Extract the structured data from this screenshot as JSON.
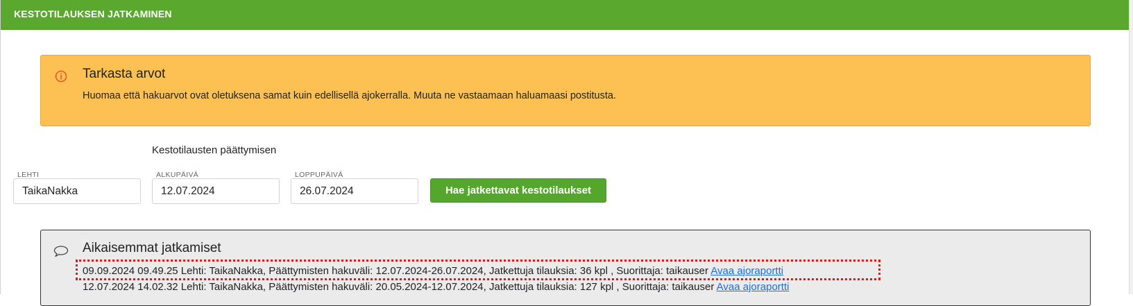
{
  "header": {
    "title": "KESTOTILAUKSEN JATKAMINEN"
  },
  "warning": {
    "icon": "info-circle-icon",
    "title": "Tarkasta arvot",
    "text": "Huomaa että hakuarvot ovat oletuksena samat kuin edellisellä ajokerralla. Muuta ne vastaamaan haluamaasi postitusta."
  },
  "form": {
    "range_label": "Kestotilausten päättymisen",
    "lehti": {
      "label": "LEHTI",
      "value": "TaikaNakka"
    },
    "alkupaiva": {
      "label": "ALKUPÄIVÄ",
      "value": "12.07.2024"
    },
    "loppupaiva": {
      "label": "LOPPUPÄIVÄ",
      "value": "26.07.2024"
    },
    "search_button": "Hae jatkettavat kestotilaukset"
  },
  "history": {
    "icon": "speech-bubble-icon",
    "title": "Aikaisemmat jatkamiset",
    "entries": [
      {
        "text": "09.09.2024 09.49.25 Lehti: TaikaNakka, Päättymisten hakuväli: 12.07.2024-26.07.2024, Jatkettuja tilauksia: 36 kpl , Suorittaja: taikauser ",
        "link": "Avaa ajoraportti"
      },
      {
        "text": "12.07.2024 14.02.32 Lehti: TaikaNakka, Päättymisten hakuväli: 20.05.2024-12.07.2024, Jatkettuja tilauksia: 127 kpl , Suorittaja: taikauser ",
        "link": "Avaa ajoraportti"
      }
    ]
  },
  "colors": {
    "header_bg": "#5ba82e",
    "warning_bg": "#fcc152",
    "button_bg": "#54a72c",
    "link": "#1a6fe0",
    "highlight": "#d21f1f"
  }
}
